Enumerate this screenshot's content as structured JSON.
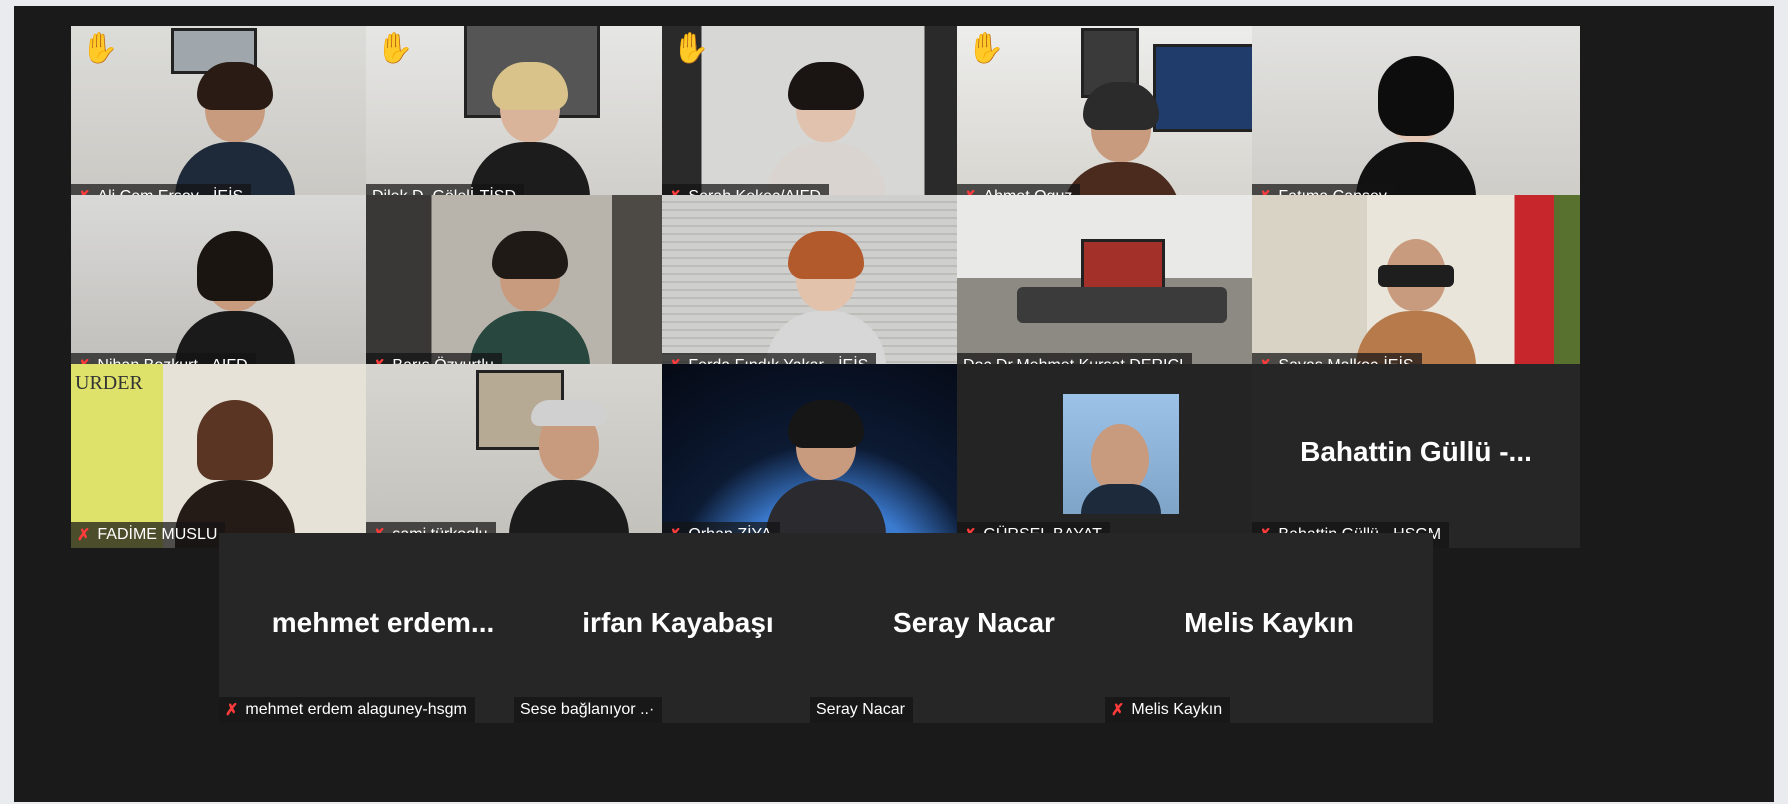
{
  "participants": [
    {
      "name": "Ali Cem Ersoy - İEİS",
      "muted": true,
      "hand_raised": true
    },
    {
      "name": "Dilek D. Gölelİ-TİSD",
      "muted": false,
      "hand_raised": true
    },
    {
      "name": "Serah Kekeç/AIFD",
      "muted": true,
      "hand_raised": true
    },
    {
      "name": "Ahmet Oguz",
      "muted": true,
      "hand_raised": true
    },
    {
      "name": "Fatıma Cansev",
      "muted": true,
      "hand_raised": false
    },
    {
      "name": "Nihan Bozkurt - AIFD",
      "muted": true,
      "hand_raised": false
    },
    {
      "name": "Barış Özyurtlu",
      "muted": true,
      "hand_raised": false
    },
    {
      "name": "Ferda Fındık Yakar - İEİS",
      "muted": true,
      "hand_raised": false
    },
    {
      "name": "Doc.Dr.Mehmet Kursat DERICI",
      "muted": false,
      "hand_raised": false,
      "active_speaker": true
    },
    {
      "name": "Savaş Malkoç-İEİS",
      "muted": true,
      "hand_raised": false
    },
    {
      "name": "FADİME MUSLU",
      "muted": true,
      "hand_raised": false,
      "background_text": "URDER"
    },
    {
      "name": "sami türkoglu",
      "muted": true,
      "hand_raised": false
    },
    {
      "name": "Orhan ZİYA",
      "muted": true,
      "hand_raised": false
    },
    {
      "name": "GÜRSEL BAYAT",
      "muted": true,
      "hand_raised": false
    },
    {
      "name": "Bahattin Güllü - HSGM",
      "display": "Bahattin Güllü -...",
      "muted": true,
      "hand_raised": false
    },
    {
      "name": "mehmet erdem alaguney-hsgm",
      "display": "mehmet  erdem...",
      "muted": true,
      "hand_raised": false
    },
    {
      "name": "Sese bağlanıyor ..·",
      "display": "irfan Kayabaşı",
      "muted": false,
      "hand_raised": false
    },
    {
      "name": "Seray Nacar",
      "display": "Seray Nacar",
      "muted": false,
      "hand_raised": false
    },
    {
      "name": "Melis Kaykın",
      "display": "Melis Kaykın",
      "muted": true,
      "hand_raised": false
    }
  ],
  "icons": {
    "mute": "microphone-muted-icon",
    "hand": "raised-hand-icon"
  },
  "colors": {
    "active_border": "#b8e34a",
    "mute_icon": "#ff3b3b",
    "hand_icon": "#f5b83d"
  }
}
